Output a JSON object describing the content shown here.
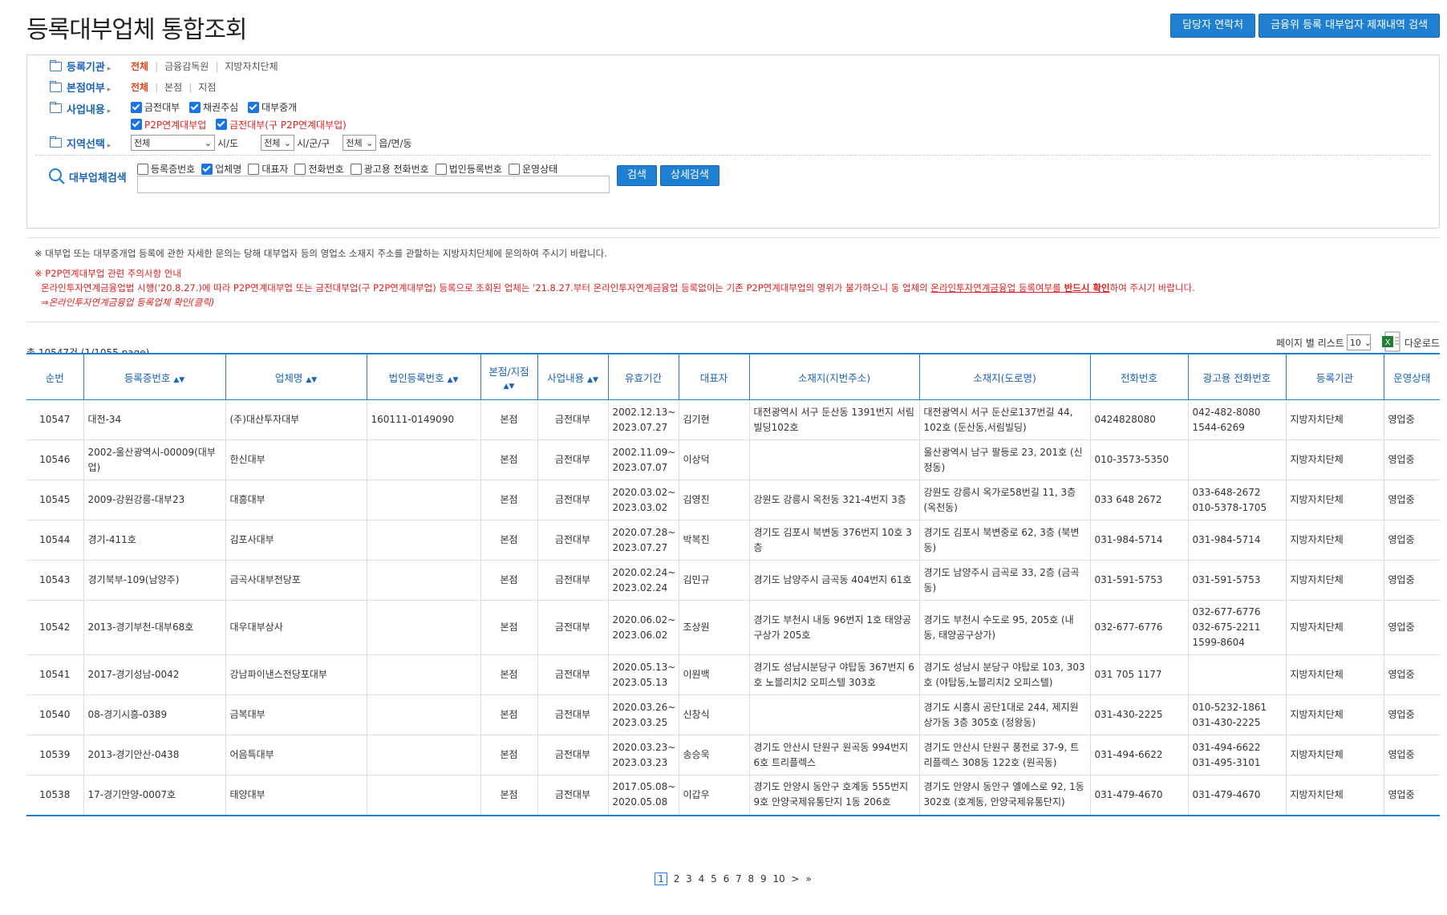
{
  "header": {
    "title": "등록대부업체 통합조회",
    "btn_contact": "담당자 연락처",
    "btn_sanctions": "금융위 등록 대부업자 제재내역 검색"
  },
  "filters": {
    "agency": {
      "label": "등록기관",
      "options": [
        "전체",
        "금융감독원",
        "지방자치단체"
      ]
    },
    "branch": {
      "label": "본점여부",
      "options": [
        "전체",
        "본점",
        "지점"
      ]
    },
    "business": {
      "label": "사업내용",
      "items": [
        "금전대부",
        "채권추심",
        "대부중개",
        "P2P연계대부업",
        "금전대부(구 P2P연계대부업)"
      ]
    },
    "region": {
      "label": "지역선택",
      "sido_value": "전체",
      "sido_suffix": "시/도",
      "sigungu_value": "전체",
      "sigungu_suffix": "시/군/구",
      "dong_value": "전체",
      "dong_suffix": "읍/면/동"
    },
    "search": {
      "label": "대부업체검색",
      "options": [
        "등록증번호",
        "업체명",
        "대표자",
        "전화번호",
        "광고용 전화번호",
        "법인등록번호",
        "운영상태"
      ],
      "btn_search": "검색",
      "btn_detail": "상세검색"
    }
  },
  "notice": {
    "line1": "※ 대부업 또는 대부중개업 등록에 관한 자세한 문의는 당해 대부업자 등의 영업소 소재지 주소를 관할하는 지방자치단체에 문의하여 주시기 바랍니다.",
    "line2": "※ P2P연계대부업 관련 주의사항 안내",
    "line3a": "온라인투자연계금융업법 시행('20.8.27.)에 따라 P2P연계대부업 또는 금전대부업(구 P2P연계대부업) 등록으로 조회된 업체는 '21.8.27.부터 온라인투자연계금융업 등록없이는 기존 P2P연계대부업의 영위가 불가하오니 동 업체의 ",
    "line3b": "온라인투자연계금융업 등록여부를",
    "line3c": " 반드시 확인",
    "line3d": "하여 주시기 바랍니다.",
    "line4": "⇒온라인투자연계금융업 등록업체 확인(클릭)"
  },
  "summary": {
    "total": "총 10547건 (1/1055 page)",
    "per_page_label": "페이지 별 리스트",
    "per_page_value": "10",
    "download": "다운로드"
  },
  "table": {
    "headers": [
      "순번",
      "등록증번호",
      "업체명",
      "법인등록번호",
      "본점/지점",
      "사업내용",
      "유효기간",
      "대표자",
      "소재지(지번주소)",
      "소재지(도로명)",
      "전화번호",
      "광고용 전화번호",
      "등록기관",
      "운영상태"
    ],
    "rows": [
      [
        "10547",
        "대전-34",
        "(주)대산투자대부",
        "160111-0149090",
        "본점",
        "금전대부",
        "2002.12.13~ 2023.07.27",
        "김기현",
        "대전광역시 서구 둔산동 1391번지 서림빌딩102호",
        "대전광역시 서구 둔산로137번길 44, 102호 (둔산동,서림빌딩)",
        "0424828080",
        "042-482-8080 1544-6269",
        "지방자치단체",
        "영업중"
      ],
      [
        "10546",
        "2002-울산광역시-00009(대부업)",
        "한신대부",
        "",
        "본점",
        "금전대부",
        "2002.11.09~ 2023.07.07",
        "이상덕",
        "",
        "울산광역시 남구 팔등로 23, 201호 (신정동)",
        "010-3573-5350",
        "",
        "지방자치단체",
        "영업중"
      ],
      [
        "10545",
        "2009-강원강릉-대부23",
        "대흥대부",
        "",
        "본점",
        "금전대부",
        "2020.03.02~ 2023.03.02",
        "김영진",
        "강원도 강릉시 옥천동 321-4번지 3층",
        "강원도 강릉시 옥가로58번길 11, 3층 (옥천동)",
        "033 648 2672",
        "033-648-2672 010-5378-1705",
        "지방자치단체",
        "영업중"
      ],
      [
        "10544",
        "경기-411호",
        "김포사대부",
        "",
        "본점",
        "금전대부",
        "2020.07.28~ 2023.07.27",
        "박복진",
        "경기도 김포시 북변동 376번지 10호 3층",
        "경기도 김포시 북변중로 62, 3층 (북변동)",
        "031-984-5714",
        "031-984-5714",
        "지방자치단체",
        "영업중"
      ],
      [
        "10543",
        "경기북부-109(남양주)",
        "금곡사대부전당포",
        "",
        "본점",
        "금전대부",
        "2020.02.24~ 2023.02.24",
        "김민규",
        "경기도 남양주시 금곡동 404번지 61호",
        "경기도 남양주시 금곡로 33, 2층 (금곡동)",
        "031-591-5753",
        "031-591-5753",
        "지방자치단체",
        "영업중"
      ],
      [
        "10542",
        "2013-경기부천-대부68호",
        "대우대부상사",
        "",
        "본점",
        "금전대부",
        "2020.06.02~ 2023.06.02",
        "조상원",
        "경기도 부천시 내동 96번지 1호 태양공구상가 205호",
        "경기도 부천시 수도로 95, 205호 (내동, 태양공구상가)",
        "032-677-6776",
        "032-677-6776 032-675-2211 1599-8604",
        "지방자치단체",
        "영업중"
      ],
      [
        "10541",
        "2017-경기성남-0042",
        "강남파이낸스전당포대부",
        "",
        "본점",
        "금전대부",
        "2020.05.13~ 2023.05.13",
        "이원백",
        "경기도 성남시분당구 야탑동 367번지 6호 노블리치2 오피스텔 303호",
        "경기도 성남시 분당구 야탑로 103, 303호 (야탑동,노블리치2 오피스텔)",
        "031 705 1177",
        "",
        "지방자치단체",
        "영업중"
      ],
      [
        "10540",
        "08-경기시흥-0389",
        "금복대부",
        "",
        "본점",
        "금전대부",
        "2020.03.26~ 2023.03.25",
        "신창식",
        "",
        "경기도 시흥시 공단1대로 244, 제지원상가동 3층 305호 (정왕동)",
        "031-430-2225",
        "010-5232-1861 031-430-2225",
        "지방자치단체",
        "영업중"
      ],
      [
        "10539",
        "2013-경기안산-0438",
        "어음특대부",
        "",
        "본점",
        "금전대부",
        "2020.03.23~ 2023.03.23",
        "송승욱",
        "경기도 안산시 단원구 원곡동 994번지 6호 트리플렉스",
        "경기도 안산시 단원구 풍전로 37-9, 트리플렉스 308동 122호 (원곡동)",
        "031-494-6622",
        "031-494-6622 031-495-3101",
        "지방자치단체",
        "영업중"
      ],
      [
        "10538",
        "17-경기안양-0007호",
        "태양대부",
        "",
        "본점",
        "금전대부",
        "2017.05.08~ 2020.05.08",
        "이갑우",
        "경기도 안양시 동안구 호계동 555번지 9호 안양국제유통단지 1동 206호",
        "경기도 안양시 동안구 엘에스로 92, 1동 302호 (호계동, 안양국제유통단지)",
        "031-479-4670",
        "031-479-4670",
        "지방자치단체",
        "영업중"
      ]
    ]
  },
  "pager": {
    "current": "1",
    "pages": [
      "2",
      "3",
      "4",
      "5",
      "6",
      "7",
      "8",
      "9",
      "10"
    ],
    "next": ">",
    "last": "»"
  },
  "colors": {
    "accent": "#1f7fd1",
    "active_option": "#e0451d",
    "warning": "#e02020"
  }
}
